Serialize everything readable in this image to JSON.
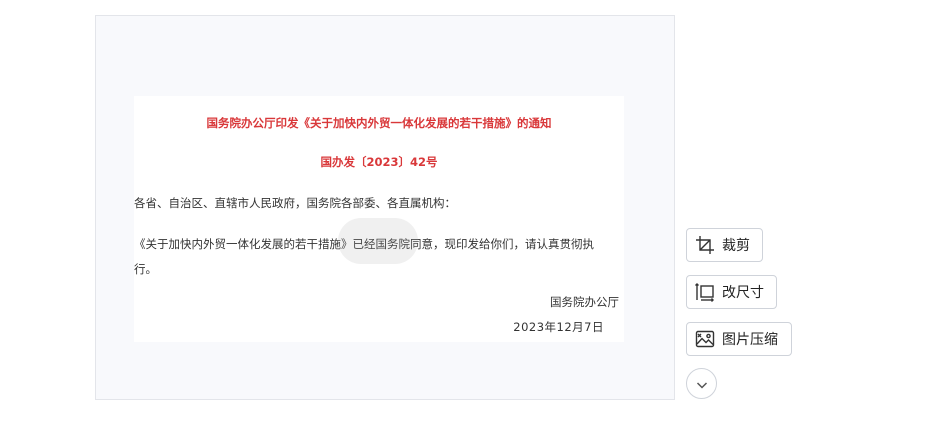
{
  "document": {
    "title": "国务院办公厅印发《关于加快内外贸一体化发展的若干措施》的通知",
    "number": "国办发〔2023〕42号",
    "recipients": "各省、自治区、直辖市人民政府，国务院各部委、各直属机构：",
    "body": "《关于加快内外贸一体化发展的若干措施》已经国务院同意，现印发给你们，请认真贯彻执行。",
    "signature_org": "国务院办公厅",
    "signature_date": "2023年12月7日"
  },
  "toolbar": {
    "crop_label": "裁剪",
    "resize_label": "改尺寸",
    "compress_label": "图片压缩",
    "more_icon": "chevron-down-icon"
  },
  "colors": {
    "title_red": "#d9383a",
    "text": "#333333",
    "border": "#cfd3da"
  }
}
